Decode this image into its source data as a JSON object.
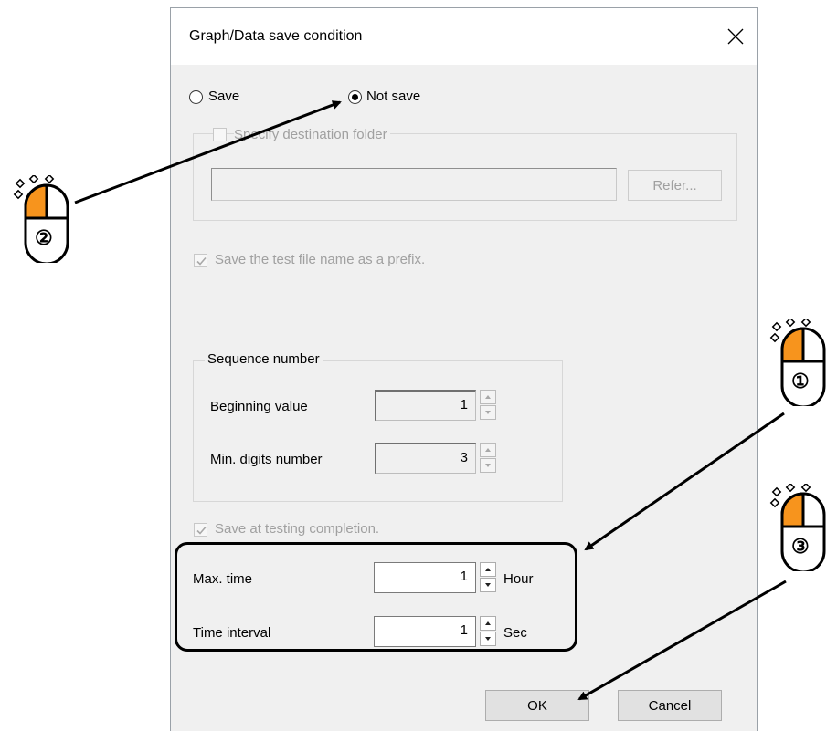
{
  "dialog": {
    "title": "Graph/Data save condition",
    "close_icon": "close-icon"
  },
  "save_mode": {
    "save_label": "Save",
    "not_save_label": "Not save",
    "selected": "not_save"
  },
  "destination": {
    "checkbox_label": "Specify destination folder",
    "checked": false,
    "path_value": "",
    "refer_label": "Refer..."
  },
  "prefix": {
    "label": "Save the test file name as a prefix.",
    "checked": true
  },
  "sequence": {
    "group_label": "Sequence number",
    "beginning_label": "Beginning value",
    "beginning_value": "1",
    "digits_label": "Min. digits number",
    "digits_value": "3"
  },
  "completion": {
    "label": "Save at testing completion.",
    "checked": true
  },
  "timing": {
    "max_time_label": "Max. time",
    "max_time_value": "1",
    "max_time_unit": "Hour",
    "interval_label": "Time interval",
    "interval_value": "1",
    "interval_unit": "Sec"
  },
  "buttons": {
    "ok_label": "OK",
    "cancel_label": "Cancel"
  },
  "annotations": {
    "step1": "①",
    "step2": "②",
    "step3": "③",
    "accent_color": "#f7941d",
    "mouse_icon": "mouse-left-click-icon"
  }
}
